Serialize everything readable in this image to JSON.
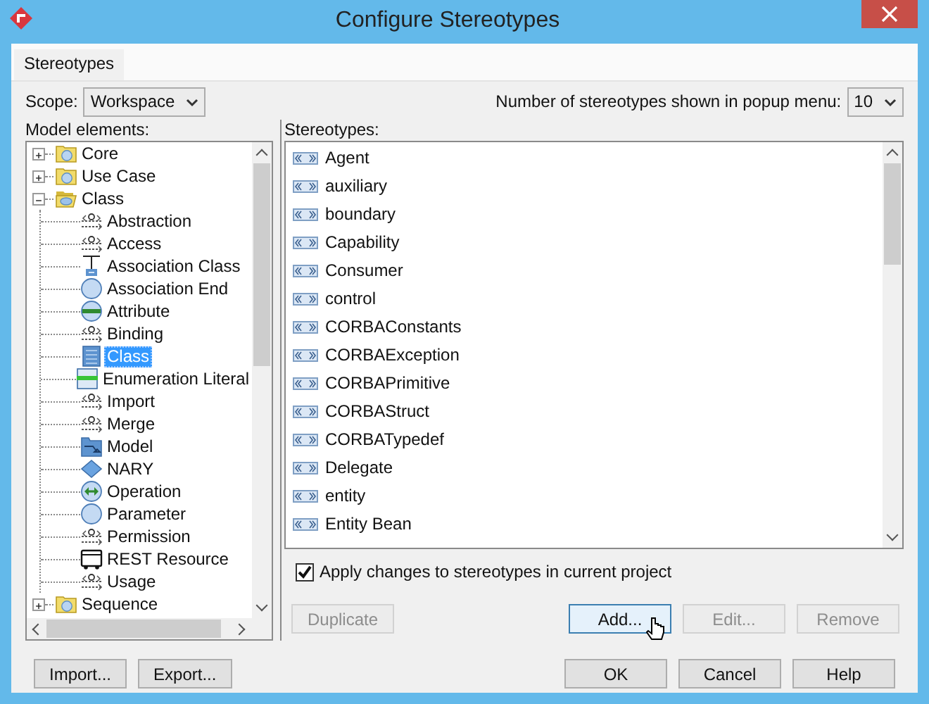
{
  "window": {
    "title": "Configure Stereotypes"
  },
  "tabs": [
    {
      "label": "Stereotypes",
      "selected": true
    }
  ],
  "scope": {
    "label": "Scope:",
    "value": "Workspace"
  },
  "popup_count": {
    "label": "Number of stereotypes shown in popup menu:",
    "value": "10"
  },
  "model_elements": {
    "label": "Model elements:",
    "items": [
      {
        "label": "Core",
        "kind": "folder",
        "expanded": false,
        "selected": false
      },
      {
        "label": "Use Case",
        "kind": "folder",
        "expanded": false,
        "selected": false
      },
      {
        "label": "Class",
        "kind": "folder",
        "expanded": true,
        "selected": false,
        "children": [
          {
            "label": "Abstraction",
            "kind": "dependency",
            "selected": false
          },
          {
            "label": "Access",
            "kind": "dependency",
            "selected": false
          },
          {
            "label": "Association Class",
            "kind": "association-class",
            "selected": false
          },
          {
            "label": "Association End",
            "kind": "circle",
            "selected": false
          },
          {
            "label": "Attribute",
            "kind": "attribute",
            "selected": false
          },
          {
            "label": "Binding",
            "kind": "dependency",
            "selected": false
          },
          {
            "label": "Class",
            "kind": "class",
            "selected": true
          },
          {
            "label": "Enumeration Literal",
            "kind": "enum-literal",
            "selected": false
          },
          {
            "label": "Import",
            "kind": "dependency",
            "selected": false
          },
          {
            "label": "Merge",
            "kind": "dependency",
            "selected": false
          },
          {
            "label": "Model",
            "kind": "model",
            "selected": false
          },
          {
            "label": "NARY",
            "kind": "diamond",
            "selected": false
          },
          {
            "label": "Operation",
            "kind": "operation",
            "selected": false
          },
          {
            "label": "Parameter",
            "kind": "circle",
            "selected": false
          },
          {
            "label": "Permission",
            "kind": "dependency",
            "selected": false
          },
          {
            "label": "REST Resource",
            "kind": "rest",
            "selected": false
          },
          {
            "label": "Usage",
            "kind": "dependency",
            "selected": false
          }
        ]
      },
      {
        "label": "Sequence",
        "kind": "folder",
        "expanded": false,
        "selected": false
      }
    ]
  },
  "stereotypes": {
    "label": "Stereotypes:",
    "items": [
      {
        "label": "Agent"
      },
      {
        "label": "auxiliary"
      },
      {
        "label": "boundary"
      },
      {
        "label": "Capability"
      },
      {
        "label": "Consumer"
      },
      {
        "label": "control"
      },
      {
        "label": "CORBAConstants"
      },
      {
        "label": "CORBAException"
      },
      {
        "label": "CORBAPrimitive"
      },
      {
        "label": "CORBAStruct"
      },
      {
        "label": "CORBATypedef"
      },
      {
        "label": "Delegate"
      },
      {
        "label": "entity"
      },
      {
        "label": "Entity Bean"
      }
    ]
  },
  "apply_changes": {
    "label": "Apply changes to stereotypes in current project",
    "checked": true
  },
  "list_buttons": [
    {
      "label": "Duplicate",
      "disabled": true,
      "hovered": false
    },
    {
      "label": "Add...",
      "disabled": false,
      "hovered": true
    },
    {
      "label": "Edit...",
      "disabled": true,
      "hovered": false
    },
    {
      "label": "Remove",
      "disabled": true,
      "hovered": false
    }
  ],
  "footer_left": [
    {
      "label": "Import...",
      "disabled": false,
      "hovered": false
    },
    {
      "label": "Export...",
      "disabled": false,
      "hovered": false
    }
  ],
  "footer_right": [
    {
      "label": "OK",
      "disabled": false,
      "hovered": false
    },
    {
      "label": "Cancel",
      "disabled": false,
      "hovered": false
    },
    {
      "label": "Help",
      "disabled": false,
      "hovered": false
    }
  ]
}
